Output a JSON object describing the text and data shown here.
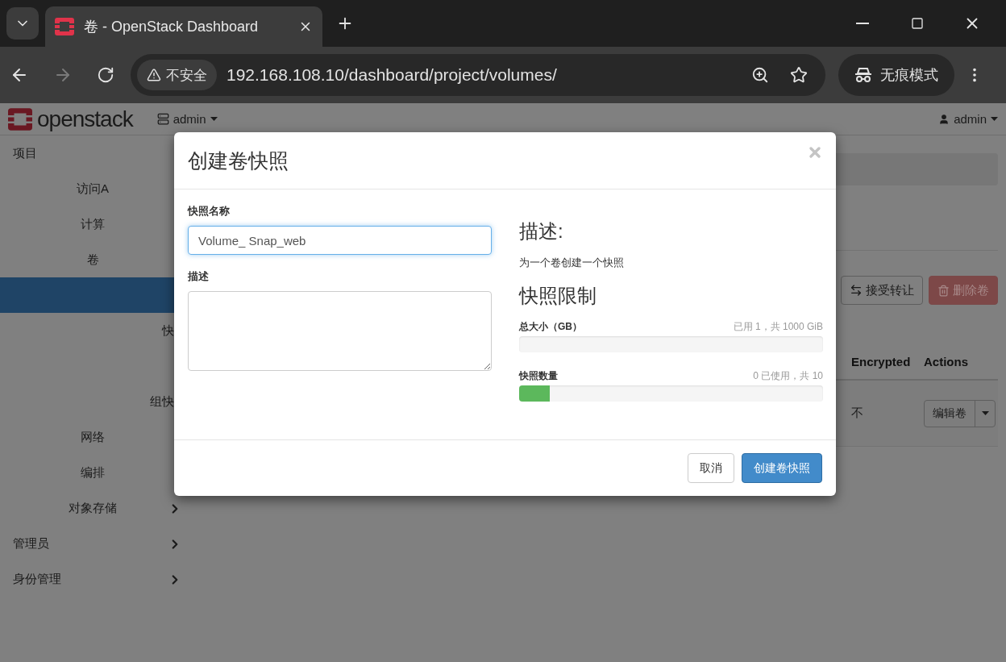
{
  "browser": {
    "tab_title": "卷 - OpenStack Dashboard",
    "security": "不安全",
    "url": "192.168.108.10/dashboard/project/volumes/",
    "incognito": "无痕模式"
  },
  "header": {
    "logo": "openstack",
    "project": "admin",
    "user": "admin"
  },
  "sidebar": {
    "items": [
      {
        "label": "项目",
        "selected": false,
        "children": [
          {
            "label": "访问A",
            "selected": false
          },
          {
            "label": "计算",
            "selected": false
          },
          {
            "label": "卷",
            "selected": false,
            "children": [
              {
                "selected": true
              },
              {
                "label": "快",
                "selected": false
              },
              {
                "selected": false
              },
              {
                "label": "组快",
                "selected": false
              }
            ]
          },
          {
            "label": "网络",
            "selected": false
          },
          {
            "label": "编排",
            "selected": false
          },
          {
            "label": "对象存储",
            "selected": false,
            "arrow": true
          }
        ]
      },
      {
        "label": "管理员",
        "selected": false,
        "arrow": true
      },
      {
        "label": "身份管理",
        "selected": false,
        "arrow": true
      }
    ]
  },
  "content": {
    "buttons": [
      {
        "label": "接受转让",
        "kind": "default"
      },
      {
        "label": "删除卷",
        "kind": "danger"
      }
    ],
    "columns": [
      "Encrypted",
      "Actions"
    ],
    "rows": [
      {
        "encrypted": "不",
        "action": "编辑卷"
      }
    ]
  },
  "modal": {
    "title": "创建卷快照",
    "name_label": "快照名称",
    "name_value": "Volume_ Snap_web",
    "desc_label": "描述",
    "info_title": "描述:",
    "info_text": "为一个卷创建一个快照",
    "limits_title": "快照限制",
    "meters": [
      {
        "label": "总大小（GB）",
        "reading": "已用 1，共 1000 GiB"
      },
      {
        "label": "快照数量",
        "reading": "0 已使用，共 10",
        "level": 0.1
      }
    ],
    "buttons": [
      {
        "label": "取消",
        "kind": "default"
      },
      {
        "label": "创建卷快照",
        "kind": "primary"
      }
    ]
  }
}
